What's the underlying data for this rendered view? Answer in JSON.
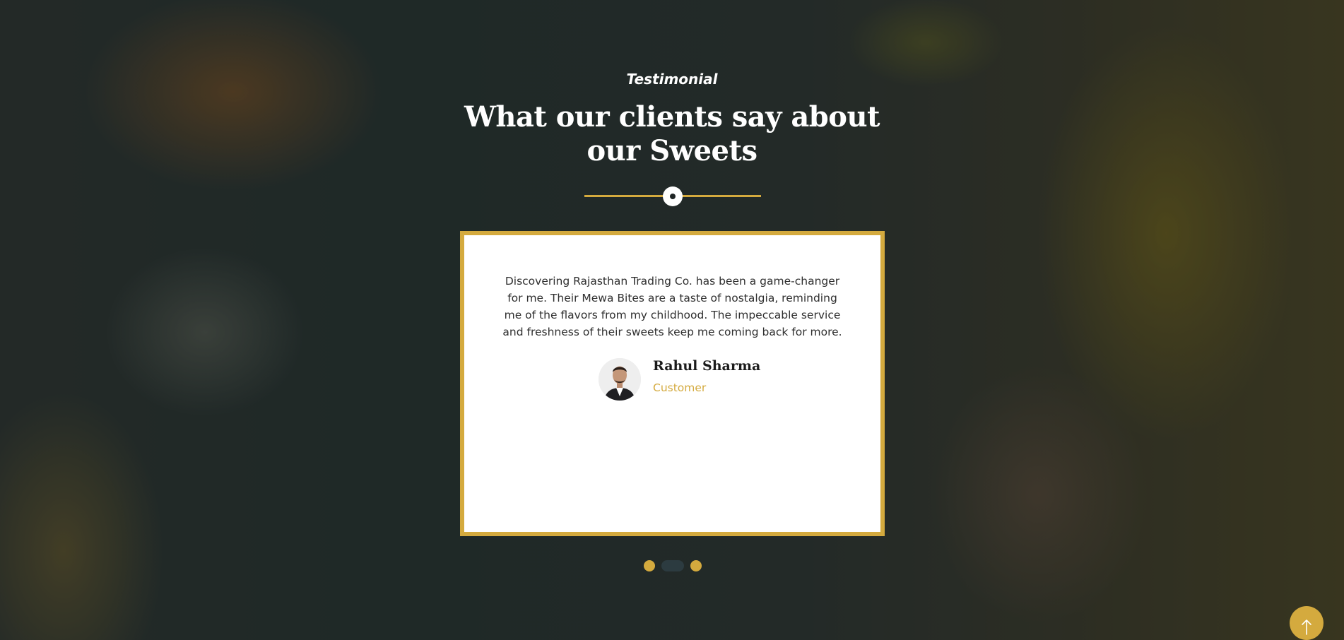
{
  "testimonial_section": {
    "eyebrow": "Testimonial",
    "heading": "What our clients say about our Sweets",
    "carousel": {
      "quote": "Discovering Rajasthan Trading Co. has been a game-changer for me. Their Mewa Bites are a taste of nostalgia, reminding me of the flavors from my childhood. The impeccable service and freshness of their sweets keep me coming back for more.",
      "author_name": "Rahul Sharma",
      "author_role": "Customer",
      "active_slide_index": 2,
      "slide_count": 3
    }
  },
  "colors": {
    "accent": "#d4aa3e",
    "card_background": "#ffffff",
    "heading_text": "#ffffff",
    "active_dot": "#2c3b40",
    "body_text": "#2f2f2f"
  },
  "icons": {
    "divider": "circle-dot-icon",
    "scroll_top": "arrow-up-icon"
  }
}
